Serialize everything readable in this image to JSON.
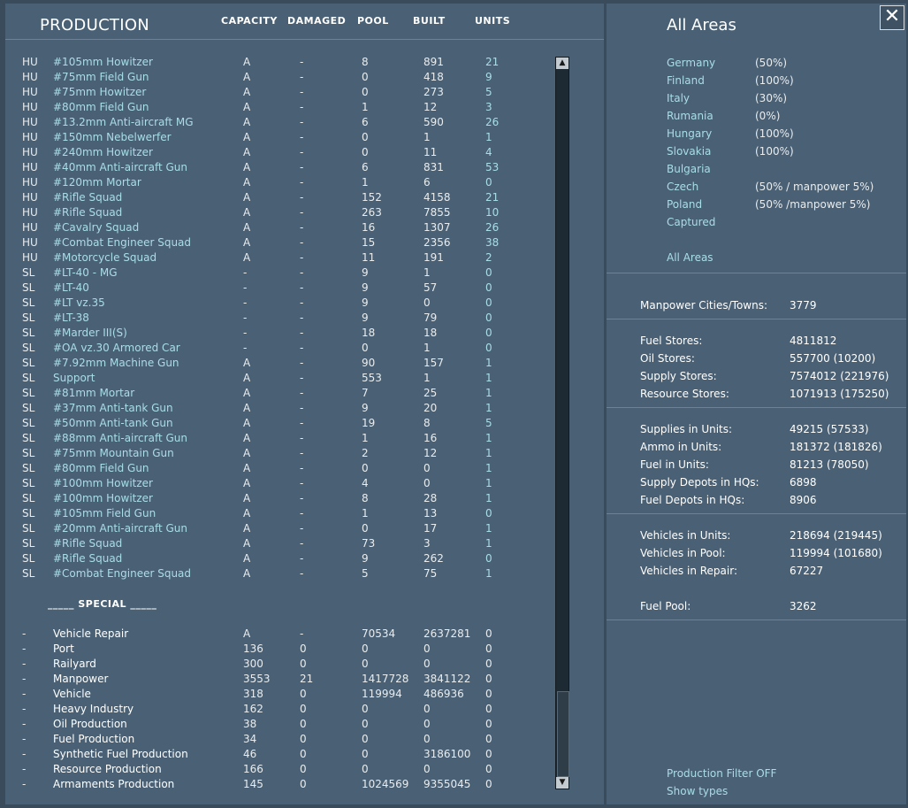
{
  "header": {
    "title": "PRODUCTION",
    "columns": [
      "CAPACITY",
      "DAMAGED",
      "POOL",
      "BUILT",
      "UNITS"
    ]
  },
  "rows": [
    {
      "nation": "HU",
      "name": "#105mm Howitzer",
      "capacity": "A",
      "damaged": "-",
      "pool": "8",
      "built": "891",
      "units": "21"
    },
    {
      "nation": "HU",
      "name": "#75mm Field Gun",
      "capacity": "A",
      "damaged": "-",
      "pool": "0",
      "built": "418",
      "units": "9"
    },
    {
      "nation": "HU",
      "name": "#75mm Howitzer",
      "capacity": "A",
      "damaged": "-",
      "pool": "0",
      "built": "273",
      "units": "5"
    },
    {
      "nation": "HU",
      "name": "#80mm Field Gun",
      "capacity": "A",
      "damaged": "-",
      "pool": "1",
      "built": "12",
      "units": "3"
    },
    {
      "nation": "HU",
      "name": "#13.2mm Anti-aircraft MG",
      "capacity": "A",
      "damaged": "-",
      "pool": "6",
      "built": "590",
      "units": "26"
    },
    {
      "nation": "HU",
      "name": "#150mm Nebelwerfer",
      "capacity": "A",
      "damaged": "-",
      "pool": "0",
      "built": "1",
      "units": "1"
    },
    {
      "nation": "HU",
      "name": "#240mm Howitzer",
      "capacity": "A",
      "damaged": "-",
      "pool": "0",
      "built": "11",
      "units": "4"
    },
    {
      "nation": "HU",
      "name": "#40mm Anti-aircraft Gun",
      "capacity": "A",
      "damaged": "-",
      "pool": "6",
      "built": "831",
      "units": "53"
    },
    {
      "nation": "HU",
      "name": "#120mm Mortar",
      "capacity": "A",
      "damaged": "-",
      "pool": "1",
      "built": "6",
      "units": "0"
    },
    {
      "nation": "HU",
      "name": "#Rifle Squad",
      "capacity": "A",
      "damaged": "-",
      "pool": "152",
      "built": "4158",
      "units": "21"
    },
    {
      "nation": "HU",
      "name": "#Rifle Squad",
      "capacity": "A",
      "damaged": "-",
      "pool": "263",
      "built": "7855",
      "units": "10"
    },
    {
      "nation": "HU",
      "name": "#Cavalry Squad",
      "capacity": "A",
      "damaged": "-",
      "pool": "16",
      "built": "1307",
      "units": "26"
    },
    {
      "nation": "HU",
      "name": "#Combat Engineer Squad",
      "capacity": "A",
      "damaged": "-",
      "pool": "15",
      "built": "2356",
      "units": "38"
    },
    {
      "nation": "HU",
      "name": "#Motorcycle Squad",
      "capacity": "A",
      "damaged": "-",
      "pool": "11",
      "built": "191",
      "units": "2"
    },
    {
      "nation": "SL",
      "name": "#LT-40 - MG",
      "capacity": "-",
      "damaged": "-",
      "pool": "9",
      "built": "1",
      "units": "0"
    },
    {
      "nation": "SL",
      "name": "#LT-40",
      "capacity": "-",
      "damaged": "-",
      "pool": "9",
      "built": "57",
      "units": "0"
    },
    {
      "nation": "SL",
      "name": "#LT vz.35",
      "capacity": "-",
      "damaged": "-",
      "pool": "9",
      "built": "0",
      "units": "0"
    },
    {
      "nation": "SL",
      "name": "#LT-38",
      "capacity": "-",
      "damaged": "-",
      "pool": "9",
      "built": "79",
      "units": "0"
    },
    {
      "nation": "SL",
      "name": "#Marder III(S)",
      "capacity": "-",
      "damaged": "-",
      "pool": "18",
      "built": "18",
      "units": "0"
    },
    {
      "nation": "SL",
      "name": "#OA vz.30 Armored Car",
      "capacity": "-",
      "damaged": "-",
      "pool": "0",
      "built": "1",
      "units": "0"
    },
    {
      "nation": "SL",
      "name": "#7.92mm Machine Gun",
      "capacity": "A",
      "damaged": "-",
      "pool": "90",
      "built": "157",
      "units": "1"
    },
    {
      "nation": "SL",
      "name": "Support",
      "capacity": "A",
      "damaged": "-",
      "pool": "553",
      "built": "1",
      "units": "1"
    },
    {
      "nation": "SL",
      "name": "#81mm Mortar",
      "capacity": "A",
      "damaged": "-",
      "pool": "7",
      "built": "25",
      "units": "1"
    },
    {
      "nation": "SL",
      "name": "#37mm Anti-tank Gun",
      "capacity": "A",
      "damaged": "-",
      "pool": "9",
      "built": "20",
      "units": "1"
    },
    {
      "nation": "SL",
      "name": "#50mm Anti-tank Gun",
      "capacity": "A",
      "damaged": "-",
      "pool": "19",
      "built": "8",
      "units": "5"
    },
    {
      "nation": "SL",
      "name": "#88mm Anti-aircraft Gun",
      "capacity": "A",
      "damaged": "-",
      "pool": "1",
      "built": "16",
      "units": "1"
    },
    {
      "nation": "SL",
      "name": "#75mm Mountain Gun",
      "capacity": "A",
      "damaged": "-",
      "pool": "2",
      "built": "12",
      "units": "1"
    },
    {
      "nation": "SL",
      "name": "#80mm Field Gun",
      "capacity": "A",
      "damaged": "-",
      "pool": "0",
      "built": "0",
      "units": "1"
    },
    {
      "nation": "SL",
      "name": "#100mm Howitzer",
      "capacity": "A",
      "damaged": "-",
      "pool": "4",
      "built": "0",
      "units": "1"
    },
    {
      "nation": "SL",
      "name": "#100mm Howitzer",
      "capacity": "A",
      "damaged": "-",
      "pool": "8",
      "built": "28",
      "units": "1"
    },
    {
      "nation": "SL",
      "name": "#105mm Field Gun",
      "capacity": "A",
      "damaged": "-",
      "pool": "1",
      "built": "13",
      "units": "0"
    },
    {
      "nation": "SL",
      "name": "#20mm Anti-aircraft Gun",
      "capacity": "A",
      "damaged": "-",
      "pool": "0",
      "built": "17",
      "units": "1"
    },
    {
      "nation": "SL",
      "name": "#Rifle Squad",
      "capacity": "A",
      "damaged": "-",
      "pool": "73",
      "built": "3",
      "units": "1"
    },
    {
      "nation": "SL",
      "name": "#Rifle Squad",
      "capacity": "A",
      "damaged": "-",
      "pool": "9",
      "built": "262",
      "units": "0"
    },
    {
      "nation": "SL",
      "name": "#Combat Engineer Squad",
      "capacity": "A",
      "damaged": "-",
      "pool": "5",
      "built": "75",
      "units": "1"
    }
  ],
  "special": {
    "header": "_____ SPECIAL _____",
    "rows": [
      {
        "nation": "-",
        "name": "Vehicle Repair",
        "capacity": "A",
        "damaged": "-",
        "pool": "70534",
        "built": "2637281",
        "units": "0"
      },
      {
        "nation": "-",
        "name": "Port",
        "capacity": "136",
        "damaged": "0",
        "pool": "0",
        "built": "0",
        "units": "0"
      },
      {
        "nation": "-",
        "name": "Railyard",
        "capacity": "300",
        "damaged": "0",
        "pool": "0",
        "built": "0",
        "units": "0"
      },
      {
        "nation": "-",
        "name": "Manpower",
        "capacity": "3553",
        "damaged": "21",
        "pool": "1417728",
        "built": "3841122",
        "units": "0"
      },
      {
        "nation": "-",
        "name": "Vehicle",
        "capacity": "318",
        "damaged": "0",
        "pool": "119994",
        "built": "486936",
        "units": "0"
      },
      {
        "nation": "-",
        "name": "Heavy Industry",
        "capacity": "162",
        "damaged": "0",
        "pool": "0",
        "built": "0",
        "units": "0"
      },
      {
        "nation": "-",
        "name": "Oil Production",
        "capacity": "38",
        "damaged": "0",
        "pool": "0",
        "built": "0",
        "units": "0"
      },
      {
        "nation": "-",
        "name": "Fuel Production",
        "capacity": "34",
        "damaged": "0",
        "pool": "0",
        "built": "0",
        "units": "0"
      },
      {
        "nation": "-",
        "name": "Synthetic Fuel Production",
        "capacity": "46",
        "damaged": "0",
        "pool": "0",
        "built": "3186100",
        "units": "0"
      },
      {
        "nation": "-",
        "name": "Resource Production",
        "capacity": "166",
        "damaged": "0",
        "pool": "0",
        "built": "0",
        "units": "0"
      },
      {
        "nation": "-",
        "name": "Armaments Production",
        "capacity": "145",
        "damaged": "0",
        "pool": "1024569",
        "built": "9355045",
        "units": "0"
      }
    ]
  },
  "scrollbar": {
    "up_icon": "▲",
    "down_icon": "▼"
  },
  "areas": {
    "title": "All Areas",
    "items": [
      {
        "name": "Germany",
        "pct": "(50%)"
      },
      {
        "name": "Finland",
        "pct": "(100%)"
      },
      {
        "name": "Italy",
        "pct": "(30%)"
      },
      {
        "name": "Rumania",
        "pct": "(0%)"
      },
      {
        "name": "Hungary",
        "pct": "(100%)"
      },
      {
        "name": "Slovakia",
        "pct": "(100%)"
      },
      {
        "name": "Bulgaria",
        "pct": ""
      },
      {
        "name": "Czech",
        "pct": "(50% / manpower 5%)"
      },
      {
        "name": "Poland",
        "pct": "(50% /manpower 5%)"
      },
      {
        "name": "Captured",
        "pct": ""
      }
    ],
    "all_link": "All Areas"
  },
  "stats": {
    "manpower": [
      {
        "label": "Manpower Cities/Towns:",
        "value": "3779"
      }
    ],
    "stores": [
      {
        "label": "Fuel Stores:",
        "value": "4811812"
      },
      {
        "label": "Oil Stores:",
        "value": "557700 (10200)"
      },
      {
        "label": "Supply Stores:",
        "value": "7574012 (221976)"
      },
      {
        "label": "Resource Stores:",
        "value": "1071913 (175250)"
      }
    ],
    "units": [
      {
        "label": "Supplies in Units:",
        "value": "49215 (57533)"
      },
      {
        "label": "Ammo in Units:",
        "value": "181372 (181826)"
      },
      {
        "label": "Fuel in Units:",
        "value": "81213 (78050)"
      },
      {
        "label": "Supply Depots in HQs:",
        "value": "6898"
      },
      {
        "label": "Fuel Depots in HQs:",
        "value": "8906"
      }
    ],
    "vehicles": [
      {
        "label": "Vehicles in Units:",
        "value": "218694 (219445)"
      },
      {
        "label": "Vehicles in Pool:",
        "value": "119994 (101680)"
      },
      {
        "label": "Vehicles in Repair:",
        "value": "67227"
      }
    ],
    "fuel_pool": {
      "label": "Fuel Pool:",
      "value": "3262"
    }
  },
  "footer": {
    "filter": "Production Filter OFF",
    "show_types": "Show types"
  },
  "close_icon": "✕"
}
